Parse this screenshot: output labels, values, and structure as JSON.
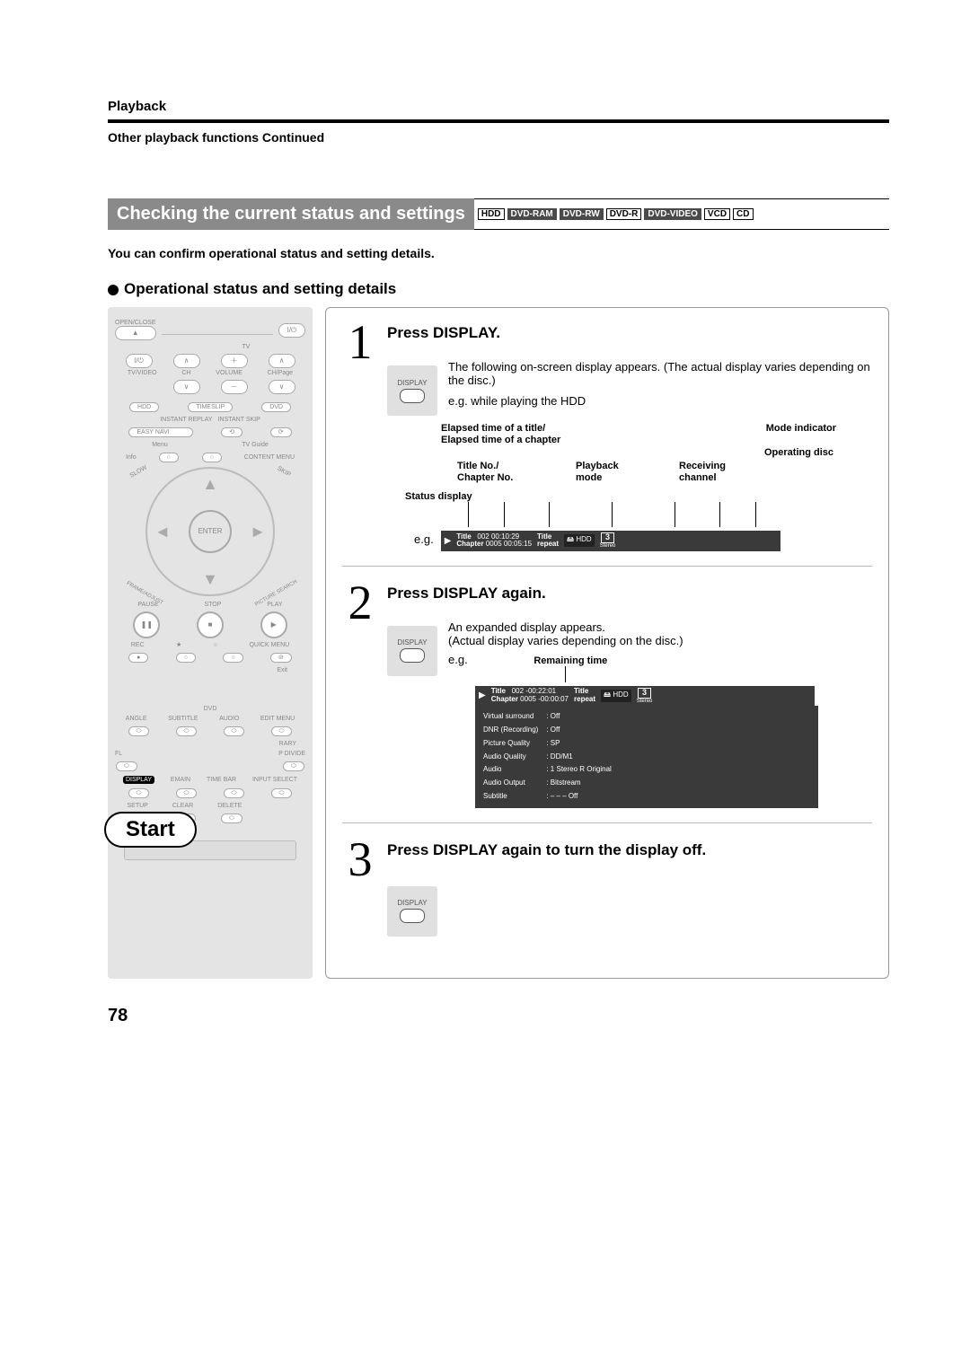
{
  "header": {
    "section": "Playback",
    "subsection": "Other playback functions Continued"
  },
  "title": "Checking the current status and settings",
  "media_badges": [
    "HDD",
    "DVD-RAM",
    "DVD-RW",
    "DVD-R",
    "DVD-VIDEO",
    "VCD",
    "CD"
  ],
  "intro": "You can confirm operational status and setting details.",
  "subhead": "Operational status and setting details",
  "remote": {
    "open_close": "OPEN/CLOSE",
    "tv": "TV",
    "power": "I/⏻",
    "tv_video": "TV/VIDEO",
    "ch": "CH",
    "volume": "VOLUME",
    "ch_page": "CH/Page",
    "hdd": "HDD",
    "timeslip": "TIMESLIP",
    "dvd": "DVD",
    "instant_replay": "INSTANT REPLAY",
    "instant_skip": "INSTANT SKIP",
    "easy_navi": "EASY NAVI",
    "menu": "Menu",
    "tv_guide": "TV Guide",
    "info": "Info",
    "content_menu": "CONTENT MENU",
    "slow": "SLOW",
    "skip": "SKIP",
    "enter": "ENTER",
    "frame_adjust": "FRAME/ADJUST",
    "picture_search": "PICTURE SEARCH",
    "pause": "PAUSE",
    "stop": "STOP",
    "play": "PLAY",
    "rec": "REC",
    "quick_menu": "QUICK MENU",
    "exit": "Exit",
    "dvd_row": "DVD",
    "angle": "ANGLE",
    "subtitle": "SUBTITLE",
    "audio": "AUDIO",
    "edit_menu": "EDIT MENU",
    "library": "LIBRARY",
    "chap_divide": "CHAP DIVIDE",
    "fl": "FL",
    "display": "DISPLAY",
    "remain": "REMAIN",
    "time_bar": "TIME BAR",
    "input_select": "INPUT SELECT",
    "setup": "SETUP",
    "clear": "CLEAR",
    "delete": "DELETE",
    "start_callout": "Start"
  },
  "steps": {
    "s1": {
      "num": "1",
      "title": "Press DISPLAY.",
      "key_label": "DISPLAY",
      "desc1": "The following on-screen display appears. (The actual display varies depending on the disc.)",
      "desc2": "e.g. while playing the HDD",
      "labels": {
        "elapsed_title": "Elapsed time of a title/",
        "elapsed_chapter": "Elapsed time of a chapter",
        "mode_indicator": "Mode indicator",
        "operating_disc": "Operating disc",
        "title_chapter": "Title No./\nChapter No.",
        "playback_mode": "Playback\nmode",
        "receiving_channel": "Receiving\nchannel",
        "status_display": "Status display",
        "eg": "e.g."
      },
      "strip": {
        "title_label": "Title",
        "title_val": "002",
        "title_time": "00:10:29",
        "chapter_label": "Chapter",
        "chapter_val": "0005",
        "chapter_time": "00:05:15",
        "repeat_label": "Title\nrepeat",
        "disc": "HDD",
        "ch": "3",
        "stereo": "Stereo"
      }
    },
    "s2": {
      "num": "2",
      "title": "Press DISPLAY again.",
      "key_label": "DISPLAY",
      "desc1": "An expanded display appears.",
      "desc2": "(Actual display varies depending on the disc.)",
      "eg": "e.g.",
      "remaining_label": "Remaining time",
      "strip": {
        "title_label": "Title",
        "title_val": "002",
        "title_time": "-00:22:01",
        "chapter_label": "Chapter",
        "chapter_val": "0005",
        "chapter_time": "-00:00:07",
        "repeat_label": "Title\nrepeat",
        "disc": "HDD",
        "ch": "3",
        "stereo": "Stereo"
      },
      "panel": {
        "rows": [
          [
            "Virtual surround",
            ": Off"
          ],
          [
            "DNR (Recording)",
            ": Off"
          ],
          [
            "Picture Quality",
            ": SP"
          ],
          [
            "Audio Quality",
            ": DD/M1"
          ],
          [
            "Audio",
            ": 1 Stereo R Original"
          ],
          [
            "Audio Output",
            ": Bitstream"
          ],
          [
            "Subtitle",
            ": – – – Off"
          ]
        ]
      }
    },
    "s3": {
      "num": "3",
      "title": "Press DISPLAY again to turn the display off.",
      "key_label": "DISPLAY"
    }
  },
  "page_number": "78"
}
